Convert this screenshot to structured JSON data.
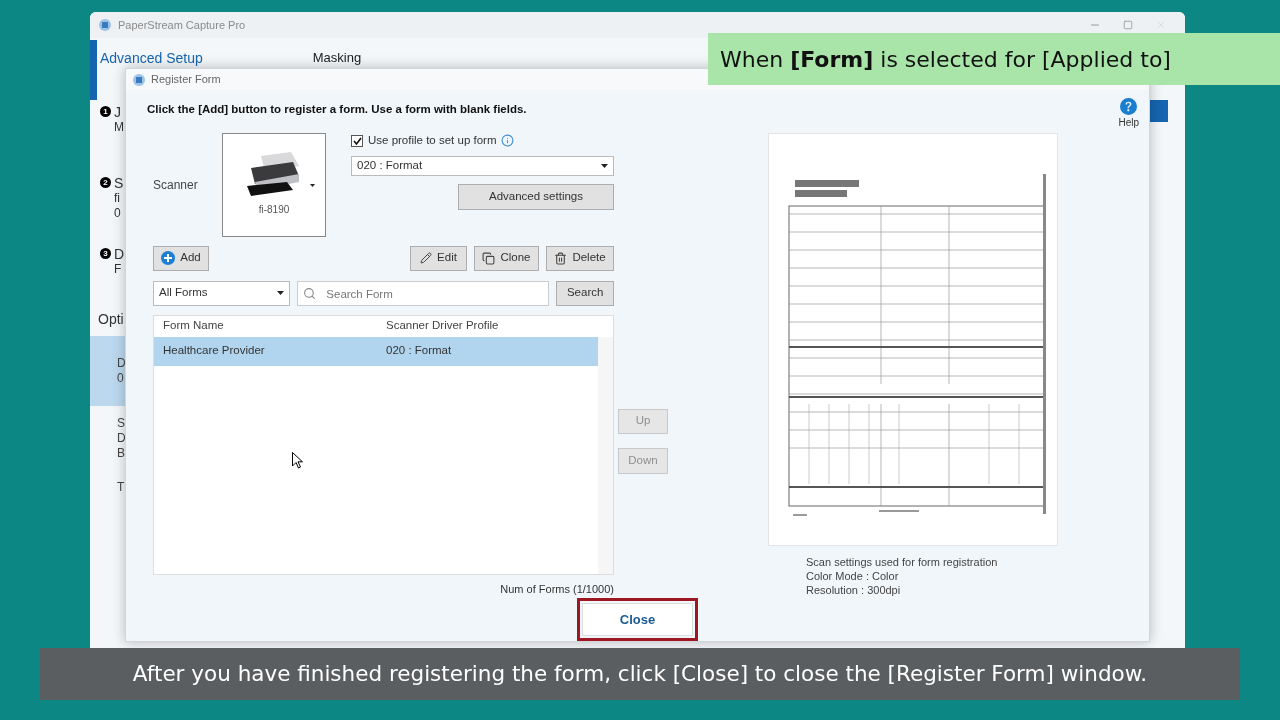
{
  "background_window": {
    "title": "PaperStream Capture Pro",
    "section": "Advanced Setup",
    "tab": "Masking",
    "steps": [
      {
        "number": "1",
        "lines": [
          "J",
          "M"
        ]
      },
      {
        "number": "2",
        "lines": [
          "S",
          "fi",
          "0"
        ]
      },
      {
        "number": "3",
        "lines": [
          "D",
          "F"
        ]
      }
    ],
    "options_heading": "Opti",
    "option_items": [
      {
        "lines": [
          "D",
          "0"
        ],
        "selected": true
      },
      {
        "lines": [
          "S",
          "D",
          "B"
        ],
        "selected": false
      },
      {
        "lines": [
          "T"
        ],
        "selected": false
      }
    ]
  },
  "dialog": {
    "title": "Register Form",
    "instruction": "Click the [Add] button to register a form. Use a form with blank fields.",
    "help_label": "Help",
    "scanner_label": "Scanner",
    "scanner_model": "fi-8190",
    "use_profile": {
      "label": "Use profile to set up form",
      "checked": true
    },
    "profile": "020 : Format",
    "advanced_button": "Advanced settings",
    "actions": [
      {
        "label": "Add",
        "kind": "add"
      },
      {
        "label": "Edit",
        "kind": "edit"
      },
      {
        "label": "Clone",
        "kind": "clone"
      },
      {
        "label": "Delete",
        "kind": "delete"
      }
    ],
    "filter": "All Forms",
    "search": {
      "placeholder": "Search Form"
    },
    "search_button": "Search",
    "table": {
      "columns": [
        "Form Name",
        "Scanner Driver Profile"
      ],
      "rows": [
        {
          "cells": [
            "Healthcare Provider",
            "020 : Format"
          ],
          "selected": true
        }
      ]
    },
    "up_button": {
      "label": "Up",
      "disabled": true
    },
    "down_button": {
      "label": "Down",
      "disabled": true
    },
    "count": "Num of Forms (1/1000)",
    "scan_settings": [
      "Scan settings used for form registration",
      "Color Mode : Color",
      "Resolution : 300dpi"
    ],
    "close_button": {
      "label": "Close",
      "highlighted": true
    }
  },
  "banner": {
    "text": "When **[Form]** is selected for [Applied to]"
  },
  "caption": {
    "text": "After you have finished registering the form, click [Close] to close the [Register Form] window."
  }
}
